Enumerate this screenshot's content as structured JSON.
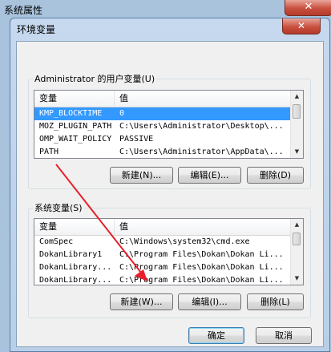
{
  "parent_window": {
    "title": "系统属性",
    "close_glyph": "✕"
  },
  "dialog": {
    "title": "环境变量",
    "close_glyph": "✕",
    "user_vars": {
      "label": "Administrator 的用户变量(U)",
      "col_variable": "变量",
      "col_value": "值",
      "rows": [
        {
          "name": "KMP_BLOCKTIME",
          "value": "0",
          "selected": true
        },
        {
          "name": "MOZ_PLUGIN_PATH",
          "value": "C:\\Users\\Administrator\\Desktop\\..."
        },
        {
          "name": "OMP_WAIT_POLICY",
          "value": "PASSIVE"
        },
        {
          "name": "PATH",
          "value": "C:\\Users\\Administrator\\AppData\\..."
        }
      ],
      "buttons": {
        "new": "新建(N)...",
        "edit": "编辑(E)...",
        "delete": "删除(D)"
      }
    },
    "system_vars": {
      "label": "系统变量(S)",
      "col_variable": "变量",
      "col_value": "值",
      "rows": [
        {
          "name": "ComSpec",
          "value": "C:\\Windows\\system32\\cmd.exe"
        },
        {
          "name": "DokanLibrary1",
          "value": "C:\\Program Files\\Dokan\\Dokan Li..."
        },
        {
          "name": "DokanLibrary...",
          "value": "C:\\Program Files\\Dokan\\Dokan Li..."
        },
        {
          "name": "DokanLibrary...",
          "value": "C:\\Program Files\\Dokan\\Dokan Li..."
        }
      ],
      "buttons": {
        "new": "新建(W)...",
        "edit": "编辑(I)...",
        "delete": "删除(L)"
      }
    },
    "ok_label": "确定",
    "cancel_label": "取消"
  },
  "colors": {
    "selection": "#3399ff",
    "annotation_arrow": "#e8202a"
  },
  "icons": {
    "scroll_up": "scroll-up-arrow-icon",
    "scroll_down": "scroll-down-arrow-icon",
    "annotation": "red-arrow-annotation-icon"
  }
}
